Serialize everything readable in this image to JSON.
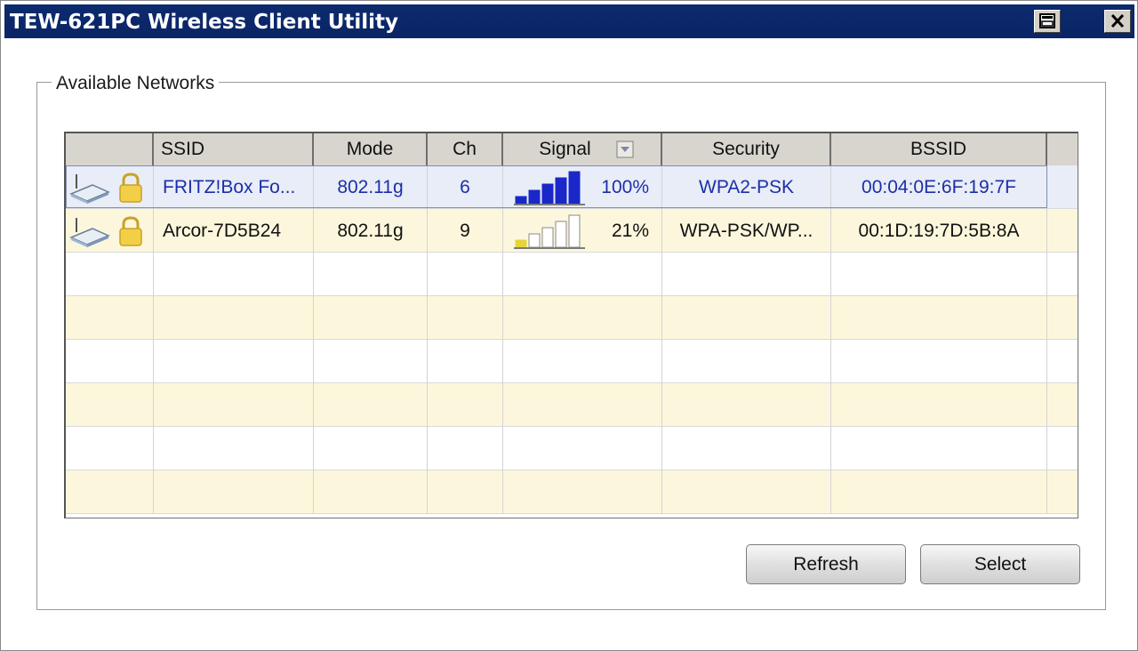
{
  "window": {
    "title": "TEW-621PC Wireless Client Utility"
  },
  "titlebar_buttons": {
    "icon_left": "taskbar-icon",
    "icon_right": "close-icon"
  },
  "group": {
    "label": "Available Networks"
  },
  "table": {
    "columns": [
      "",
      "SSID",
      "Mode",
      "Ch",
      "Signal",
      "Security",
      "BSSID"
    ],
    "sort_column": "Signal",
    "rows": [
      {
        "icons": [
          "router-icon",
          "lock-icon"
        ],
        "ssid": "FRITZ!Box Fo...",
        "mode": "802.11g",
        "ch": "6",
        "signal_level": 1.0,
        "signal": "100%",
        "security": "WPA2-PSK",
        "bssid": "00:04:0E:6F:19:7F",
        "selected": true
      },
      {
        "icons": [
          "router-icon",
          "lock-icon"
        ],
        "ssid": "Arcor-7D5B24",
        "mode": "802.11g",
        "ch": "9",
        "signal_level": 0.21,
        "signal": "21%",
        "security": "WPA-PSK/WP...",
        "bssid": "00:1D:19:7D:5B:8A",
        "selected": false
      }
    ],
    "empty_rows": 6
  },
  "buttons": {
    "refresh": "Refresh",
    "select": "Select"
  },
  "colors": {
    "titlebar": "#0c2a6e",
    "selected_text": "#1c2fa8",
    "signal_strong": "#1a27c9",
    "signal_weak": "#e6d43a",
    "row_alt": "#fcf7dc"
  }
}
